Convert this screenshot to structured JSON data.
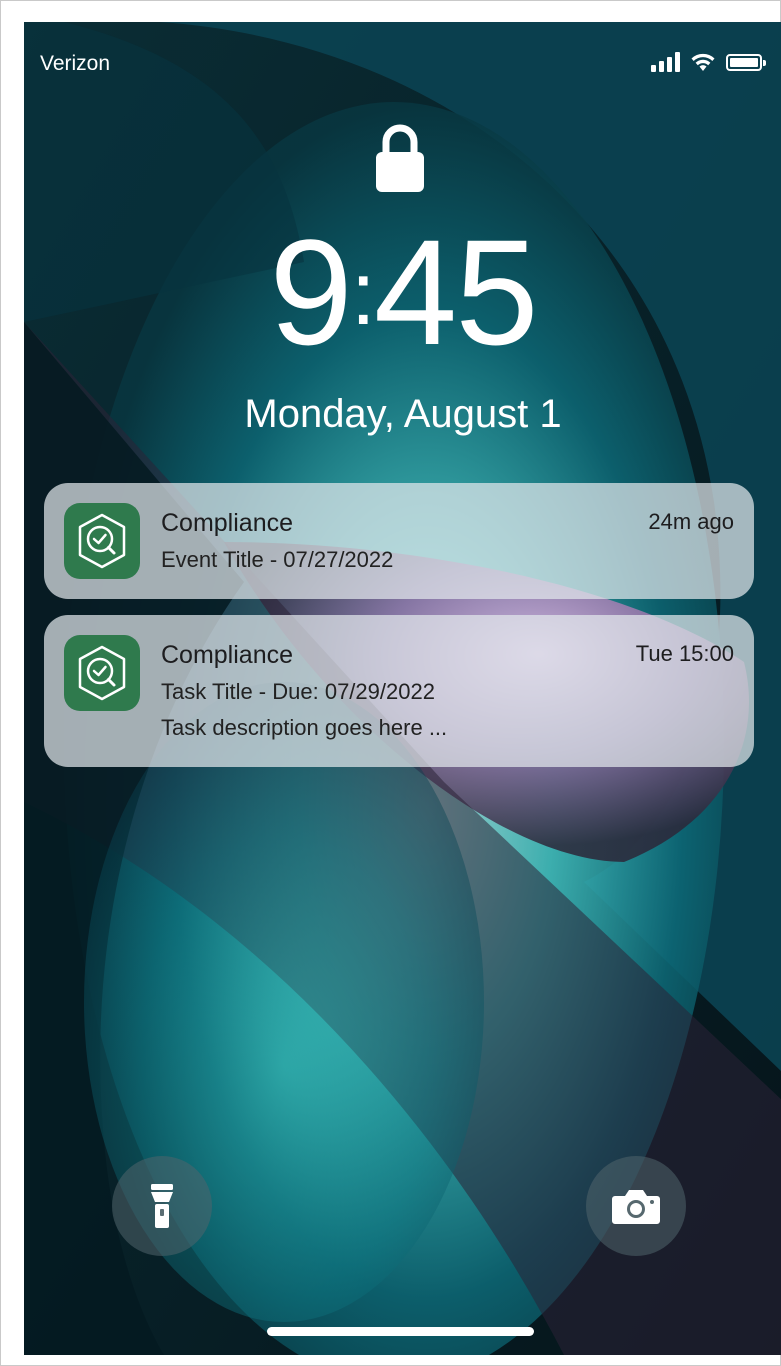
{
  "status_bar": {
    "carrier": "Verizon",
    "icons": [
      "cellular-signal-icon",
      "wifi-icon",
      "battery-icon"
    ]
  },
  "lock_screen": {
    "lock_icon": "lock-icon",
    "time_hour": "9",
    "time_separator": ":",
    "time_minutes": "45",
    "date": "Monday, August 1"
  },
  "notifications": [
    {
      "app": "Compliance",
      "time": "24m ago",
      "icon": "compliance-app-icon",
      "lines": [
        "Event Title - 07/27/2022"
      ]
    },
    {
      "app": "Compliance",
      "time": "Tue 15:00",
      "icon": "compliance-app-icon",
      "lines": [
        "Task Title - Due: 07/29/2022",
        "Task description goes here ..."
      ]
    }
  ],
  "quick_actions": {
    "left": "flashlight-icon",
    "right": "camera-icon"
  },
  "colors": {
    "app_icon_background": "#2f7a4d",
    "notification_background": "rgba(226,232,235,0.72)",
    "text_primary": "#1d1d1f",
    "lockscreen_text": "#ffffff"
  }
}
